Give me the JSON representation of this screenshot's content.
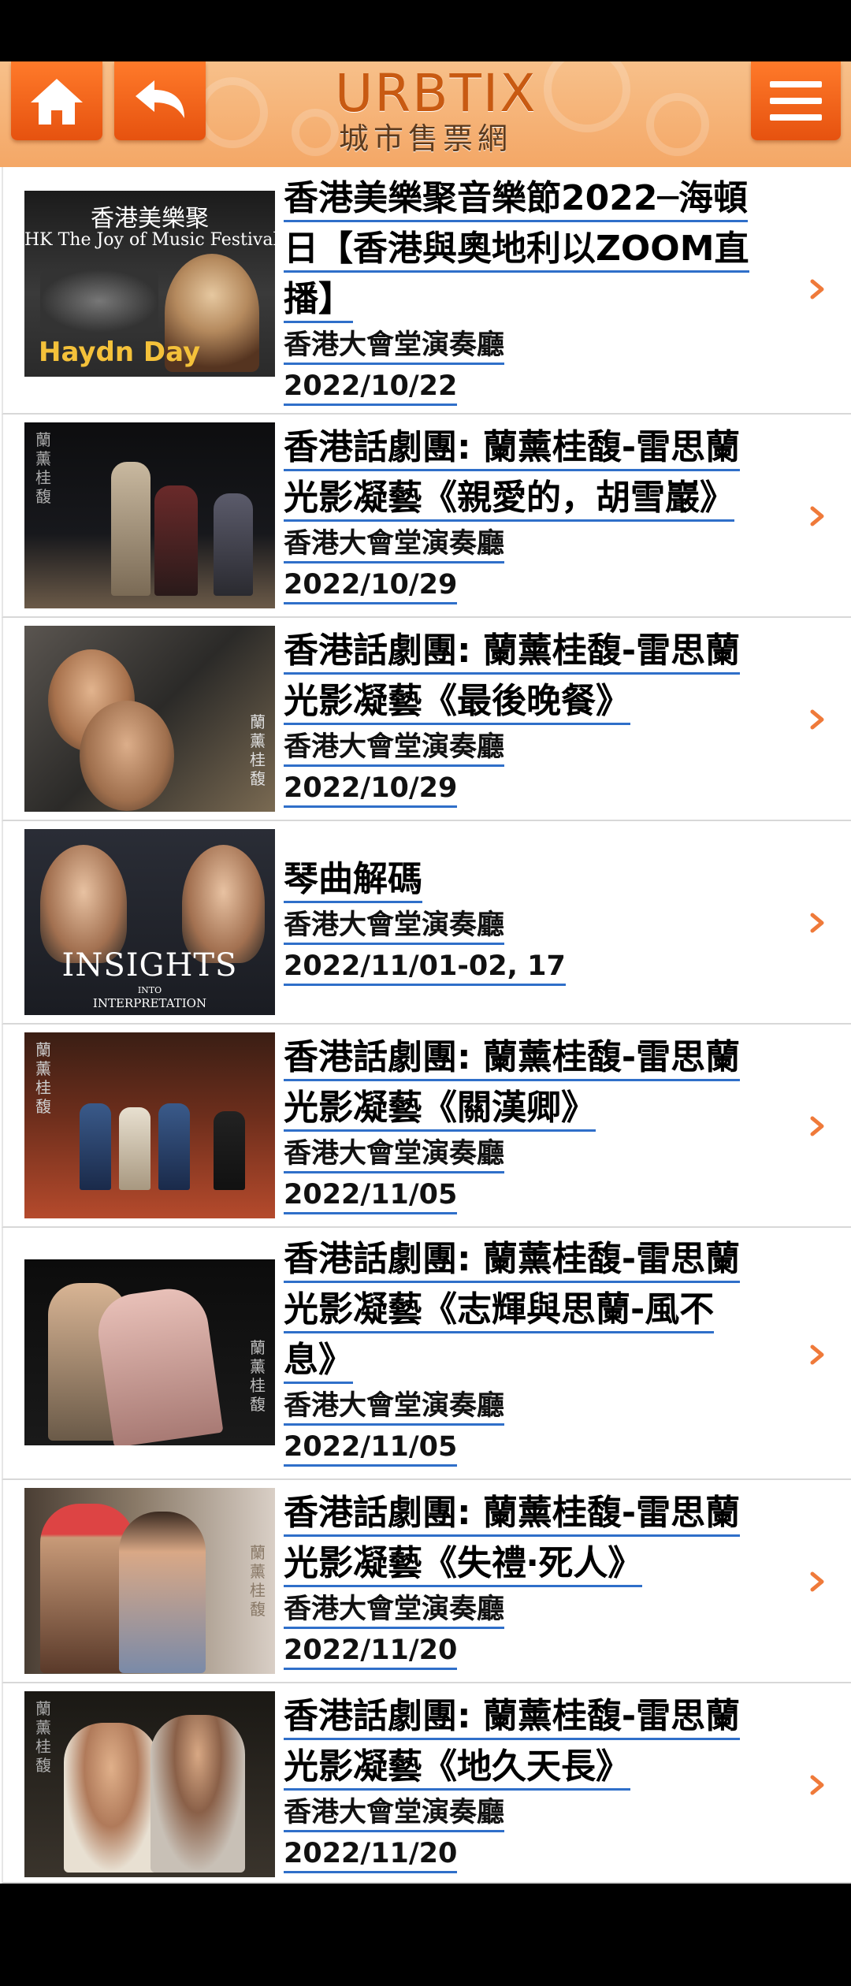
{
  "header": {
    "logo_en": "URBTIX",
    "logo_zh": "城市售票網"
  },
  "events": [
    {
      "title": "香港美樂聚音樂節2022─海頓日【香港與奧地利以ZOOM直播】",
      "title_lines": [
        "香港美樂聚音樂節2022─海頓",
        "日【香港與奧地利以ZOOM直",
        "播】"
      ],
      "venue": "香港大會堂演奏廳",
      "date": "2022/10/22",
      "poster_text": [
        "香港美樂聚",
        "HK The Joy of Music Festival",
        "Haydn Day"
      ]
    },
    {
      "title": "香港話劇團: 蘭薰桂馥-雷思蘭光影凝藝《親愛的，胡雪巖》",
      "title_lines": [
        "香港話劇團: 蘭薰桂馥-雷思蘭",
        "光影凝藝《親愛的，胡雪巖》"
      ],
      "venue": "香港大會堂演奏廳",
      "date": "2022/10/29",
      "poster_text": [
        "蘭薰桂馥"
      ]
    },
    {
      "title": "香港話劇團: 蘭薰桂馥-雷思蘭光影凝藝《最後晚餐》",
      "title_lines": [
        "香港話劇團: 蘭薰桂馥-雷思蘭",
        "光影凝藝《最後晚餐》"
      ],
      "venue": "香港大會堂演奏廳",
      "date": "2022/10/29",
      "poster_text": [
        "蘭薰桂馥"
      ]
    },
    {
      "title": "琴曲解碼",
      "title_lines": [
        "琴曲解碼"
      ],
      "venue": "香港大會堂演奏廳",
      "date": "2022/11/01-02, 17",
      "poster_text": [
        "INSIGHTS",
        "INTO",
        "INTERPRETATION"
      ]
    },
    {
      "title": "香港話劇團: 蘭薰桂馥-雷思蘭光影凝藝《關漢卿》",
      "title_lines": [
        "香港話劇團: 蘭薰桂馥-雷思蘭",
        "光影凝藝《關漢卿》"
      ],
      "venue": "香港大會堂演奏廳",
      "date": "2022/11/05",
      "poster_text": [
        "蘭薰桂馥"
      ]
    },
    {
      "title": "香港話劇團: 蘭薰桂馥-雷思蘭光影凝藝《志輝與思蘭-風不息》",
      "title_lines": [
        "香港話劇團: 蘭薰桂馥-雷思蘭",
        "光影凝藝《志輝與思蘭-風不",
        "息》"
      ],
      "venue": "香港大會堂演奏廳",
      "date": "2022/11/05",
      "poster_text": [
        "蘭薰桂馥"
      ]
    },
    {
      "title": "香港話劇團: 蘭薰桂馥-雷思蘭光影凝藝《失禮‧死人》",
      "title_lines": [
        "香港話劇團: 蘭薰桂馥-雷思蘭",
        "光影凝藝《失禮‧死人》"
      ],
      "venue": "香港大會堂演奏廳",
      "date": "2022/11/20",
      "poster_text": [
        "蘭薰桂馥"
      ]
    },
    {
      "title": "香港話劇團: 蘭薰桂馥-雷思蘭光影凝藝《地久天長》",
      "title_lines": [
        "香港話劇團: 蘭薰桂馥-雷思蘭",
        "光影凝藝《地久天長》"
      ],
      "venue": "香港大會堂演奏廳",
      "date": "2022/11/20",
      "poster_text": [
        "蘭薰桂馥"
      ]
    }
  ],
  "colors": {
    "header_bg": "#f5b27a",
    "button": "#ef6a1e",
    "link_underline": "#2f6fc9",
    "chevron": "#ef7a3a"
  }
}
